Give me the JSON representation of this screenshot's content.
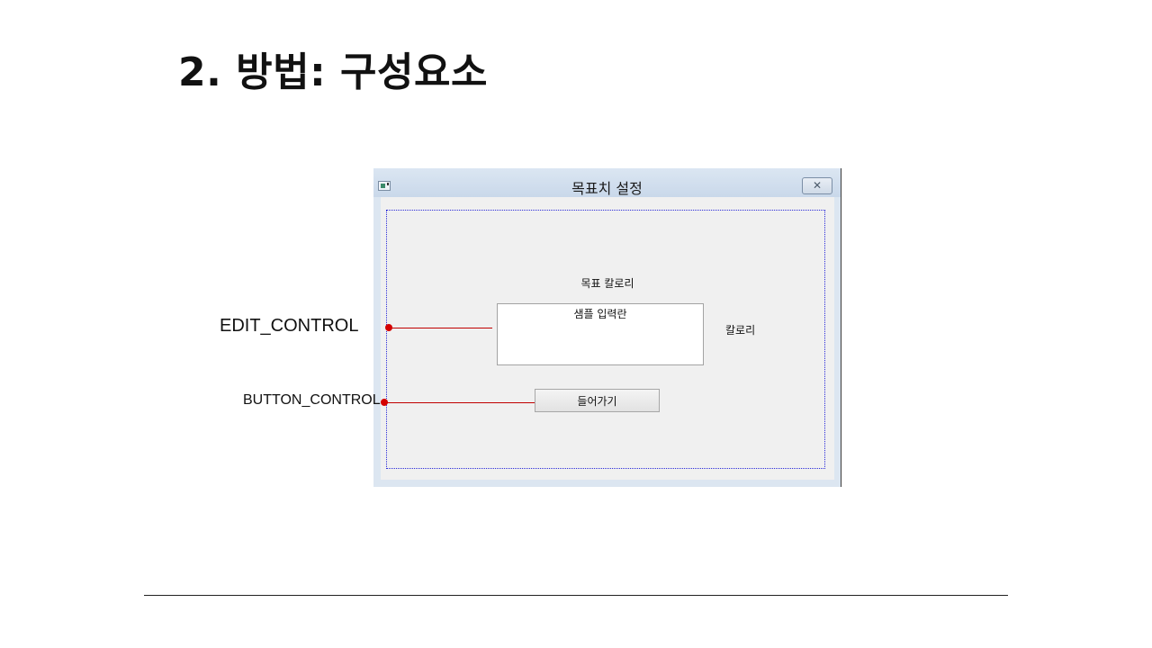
{
  "slide": {
    "title": "2. 방법: 구성요소"
  },
  "dialog": {
    "title": "목표치 설정",
    "goal_label": "목표 칼로리",
    "edit_placeholder": "샘플 입력란",
    "unit_label": "칼로리",
    "enter_button": "들어가기",
    "close_icon": "close-icon",
    "system_icon": "window-icon"
  },
  "annotations": {
    "edit": "EDIT_CONTROL",
    "button": "BUTTON_CONTROL"
  },
  "colors": {
    "connector": "#c00000",
    "frame": "#2b2bd9",
    "dialog_bg": "#dce6f1",
    "client_bg": "#f0f0f0"
  }
}
